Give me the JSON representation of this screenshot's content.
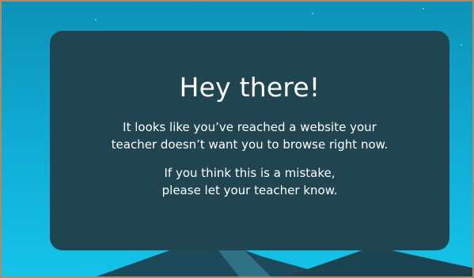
{
  "card": {
    "title": "Hey there!",
    "message_1": {
      "line_1": "It looks like you’ve reached a website your",
      "line_2": "teacher doesn’t want you to browse right now."
    },
    "message_2": {
      "line_1": "If you think this is a mistake,",
      "line_2": "please let your teacher know."
    }
  },
  "colors": {
    "background_top": "#0d93b7",
    "background_bottom": "#15c3e8",
    "card": "#214550",
    "text": "#ffffff",
    "border": "#b08a6a"
  }
}
